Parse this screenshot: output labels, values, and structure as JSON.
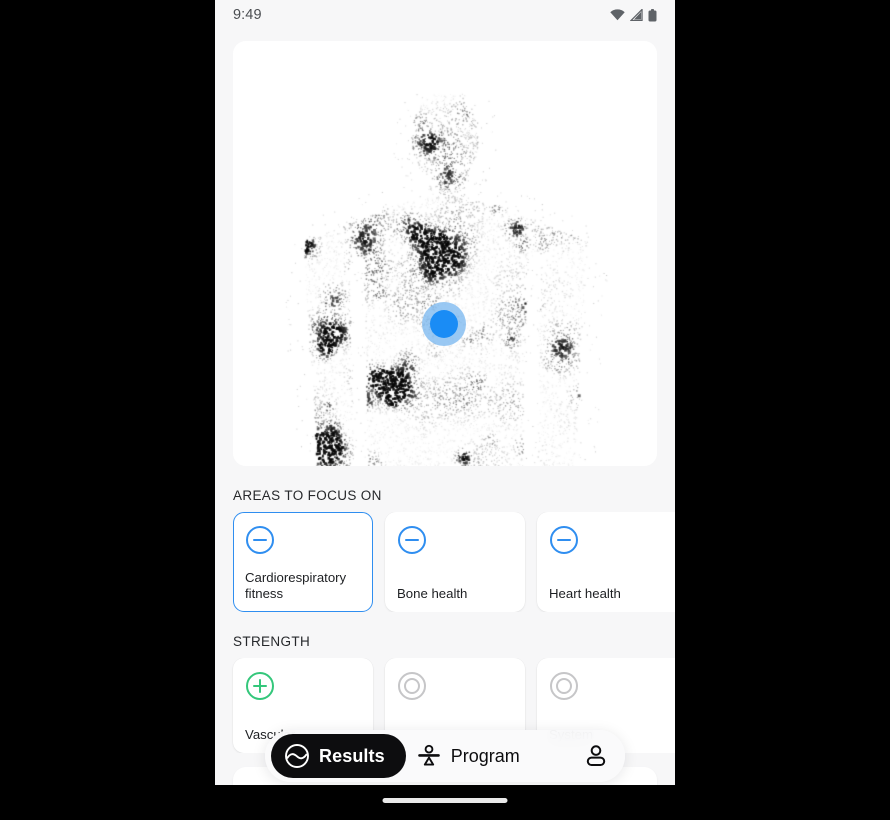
{
  "status_bar": {
    "time": "9:49",
    "icons": [
      "wifi-icon",
      "cellular-signal-icon",
      "battery-icon"
    ]
  },
  "body_visual": {
    "type": "particle-body-scan",
    "marker": {
      "name": "chest-marker",
      "inner_color": "#1a8cf5",
      "halo_color": "#7cb8f0"
    }
  },
  "sections": [
    {
      "title": "AREAS TO FOCUS ON",
      "cards": [
        {
          "label": "Cardiorespiratory fitness",
          "icon": "circle-minus-icon",
          "icon_color": "#2f8ef0",
          "selected": true
        },
        {
          "label": "Bone health",
          "icon": "circle-minus-icon",
          "icon_color": "#2f8ef0",
          "selected": false
        },
        {
          "label": "Heart health",
          "icon": "circle-minus-icon",
          "icon_color": "#2f8ef0",
          "selected": false
        }
      ]
    },
    {
      "title": "STRENGTH",
      "cards": [
        {
          "label": "Vascular",
          "icon": "circle-plus-icon",
          "icon_color": "#34c77b",
          "selected": false
        },
        {
          "label": "",
          "icon": "double-circle-icon",
          "icon_color": "#c6c6c8",
          "selected": false
        },
        {
          "label": "System",
          "icon": "double-circle-icon",
          "icon_color": "#c6c6c8",
          "selected": false
        }
      ]
    }
  ],
  "bottom_nav": {
    "items": [
      {
        "label": "Results",
        "icon": "wave-circle-icon",
        "active": true
      },
      {
        "label": "Program",
        "icon": "balance-figure-icon",
        "active": false
      },
      {
        "label": "",
        "icon": "person-icon",
        "active": false
      }
    ]
  },
  "colors": {
    "accent_blue": "#2f8ef0",
    "accent_green": "#34c77b",
    "muted_gray": "#c6c6c8",
    "page_bg": "#f7f7f8",
    "card_bg": "#ffffff",
    "nav_active_bg": "#0d0d0f"
  }
}
